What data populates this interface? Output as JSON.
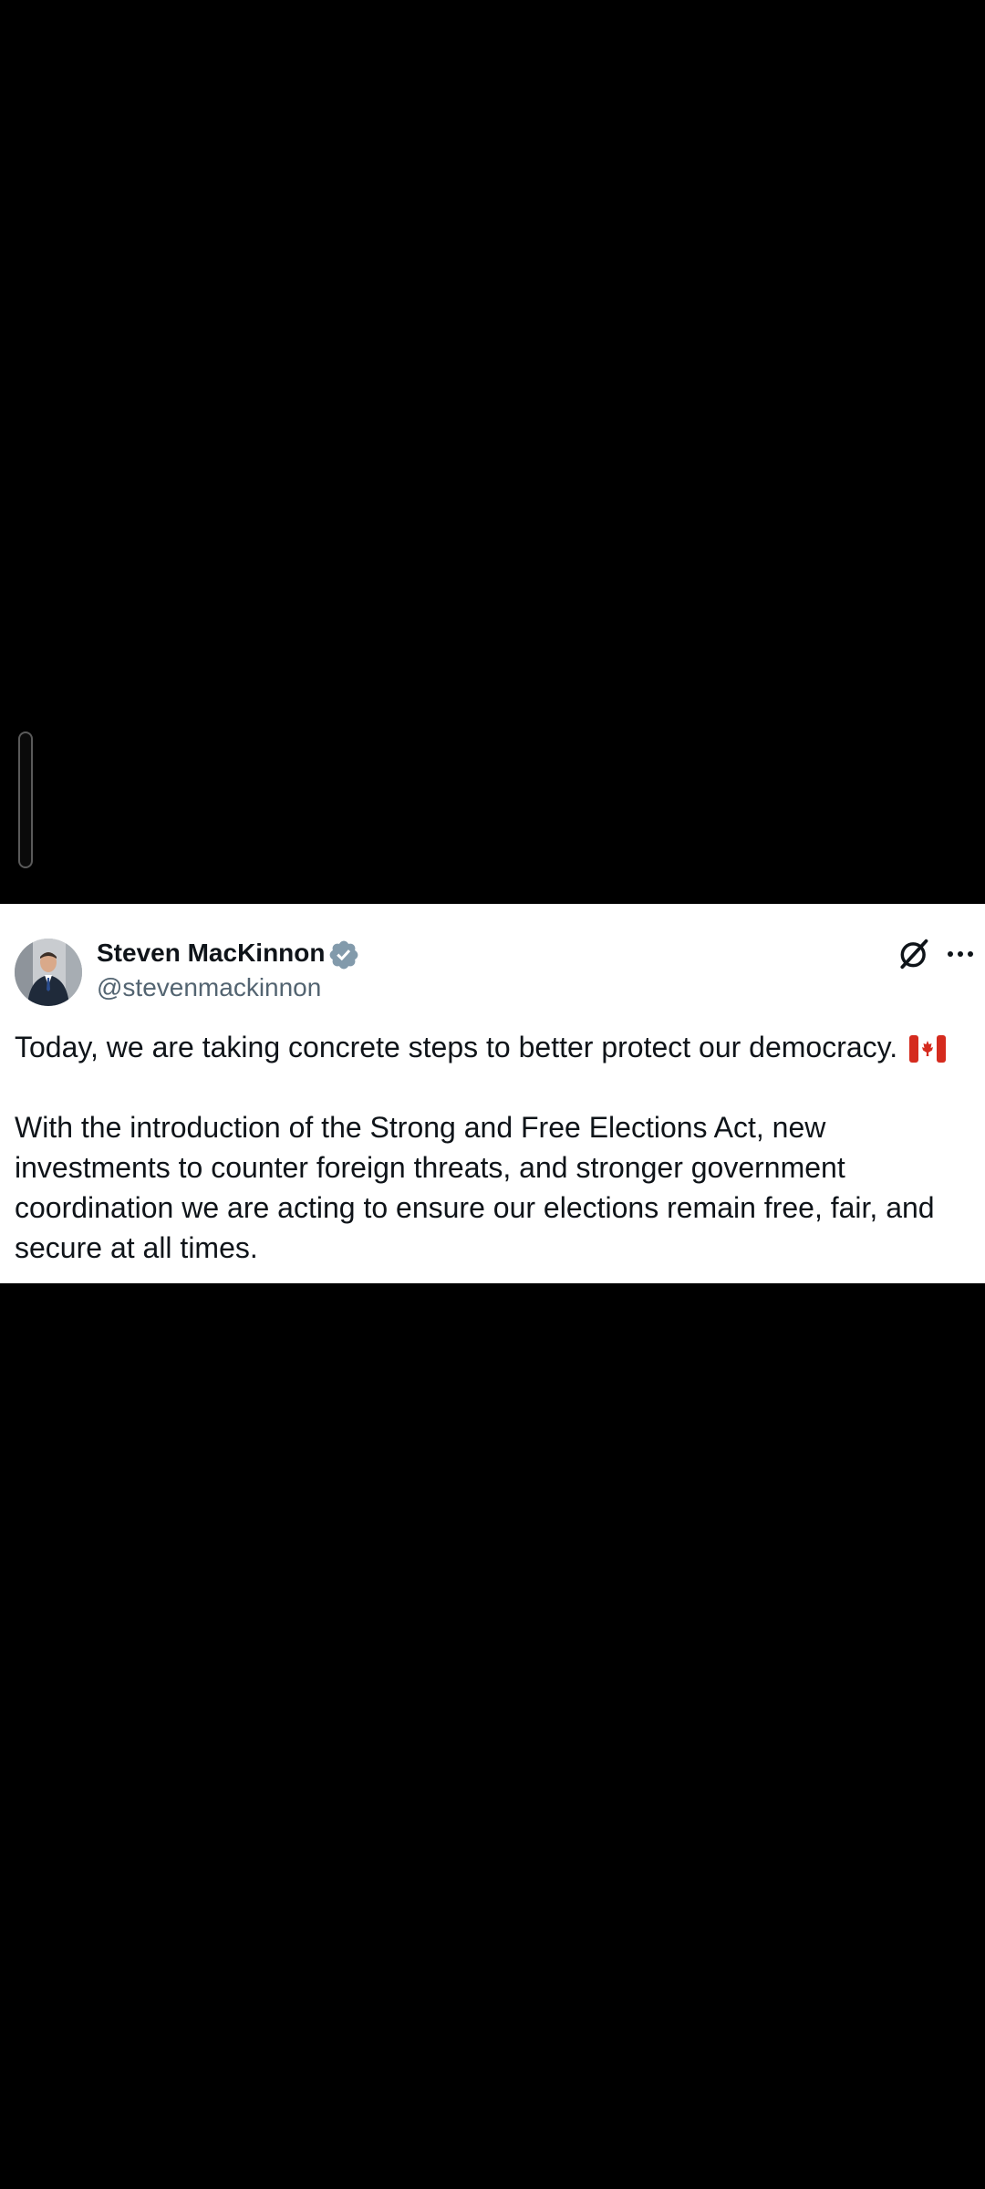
{
  "tweet": {
    "author_name": "Steven MacKinnon",
    "author_handle": "@stevenmackinnon",
    "verified_icon": "verified-badge-icon",
    "paragraph_1": "Today, we are taking concrete steps to better protect our democracy.",
    "paragraph_1_emoji": "canada-flag-icon",
    "paragraph_2": "With the introduction of the Strong and Free Elections Act, new investments to counter foreign threats, and stronger government coordination we are acting to ensure our elections remain free, fair, and secure at all times."
  },
  "actions": {
    "grok_icon": "grok-icon",
    "more_icon": "more-options-icon"
  },
  "colors": {
    "background": "#000000",
    "card": "#ffffff",
    "text_primary": "#0f1419",
    "text_secondary": "#536471",
    "verified_badge": "#829aab",
    "flag_red": "#d52b1e"
  }
}
